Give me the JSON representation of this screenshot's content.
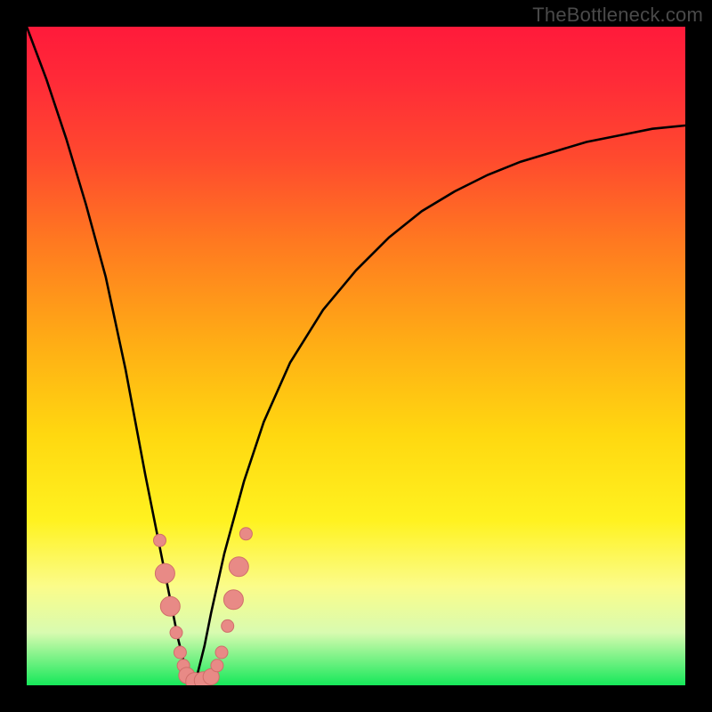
{
  "watermark": "TheBottleneck.com",
  "colors": {
    "curve": "#000000",
    "marker_fill": "#e88a86",
    "marker_stroke": "#d06e6a"
  },
  "chart_data": {
    "type": "line",
    "title": "",
    "xlabel": "",
    "ylabel": "",
    "xlim": [
      0,
      100
    ],
    "ylim": [
      0,
      100
    ],
    "note": "Bottleneck curve: y = distance from optimal (0 = green / ideal, 100 = red / worst). Minimum at x≈25.",
    "series": [
      {
        "name": "bottleneck-curve",
        "x": [
          0,
          3,
          6,
          9,
          12,
          15,
          18,
          20,
          22,
          23,
          24,
          25,
          26,
          27,
          28,
          30,
          33,
          36,
          40,
          45,
          50,
          55,
          60,
          65,
          70,
          75,
          80,
          85,
          90,
          95,
          100
        ],
        "y": [
          100,
          92,
          83,
          73,
          62,
          48,
          32,
          22,
          12,
          7,
          3,
          0.5,
          2,
          6,
          11,
          20,
          31,
          40,
          49,
          57,
          63,
          68,
          72,
          75,
          77.5,
          79.5,
          81,
          82.5,
          83.5,
          84.5,
          85
        ]
      }
    ],
    "markers": {
      "name": "data-points",
      "points": [
        {
          "x": 20.2,
          "y": 22,
          "r": 7
        },
        {
          "x": 21.0,
          "y": 17,
          "r": 11
        },
        {
          "x": 21.8,
          "y": 12,
          "r": 11
        },
        {
          "x": 22.7,
          "y": 8,
          "r": 7
        },
        {
          "x": 23.3,
          "y": 5,
          "r": 7
        },
        {
          "x": 23.8,
          "y": 3,
          "r": 7
        },
        {
          "x": 24.3,
          "y": 1.5,
          "r": 9
        },
        {
          "x": 25.5,
          "y": 0.6,
          "r": 10
        },
        {
          "x": 26.8,
          "y": 0.7,
          "r": 10
        },
        {
          "x": 28.0,
          "y": 1.3,
          "r": 9
        },
        {
          "x": 28.9,
          "y": 3,
          "r": 7
        },
        {
          "x": 29.6,
          "y": 5,
          "r": 7
        },
        {
          "x": 30.5,
          "y": 9,
          "r": 7
        },
        {
          "x": 31.4,
          "y": 13,
          "r": 11
        },
        {
          "x": 32.2,
          "y": 18,
          "r": 11
        },
        {
          "x": 33.3,
          "y": 23,
          "r": 7
        }
      ]
    }
  }
}
